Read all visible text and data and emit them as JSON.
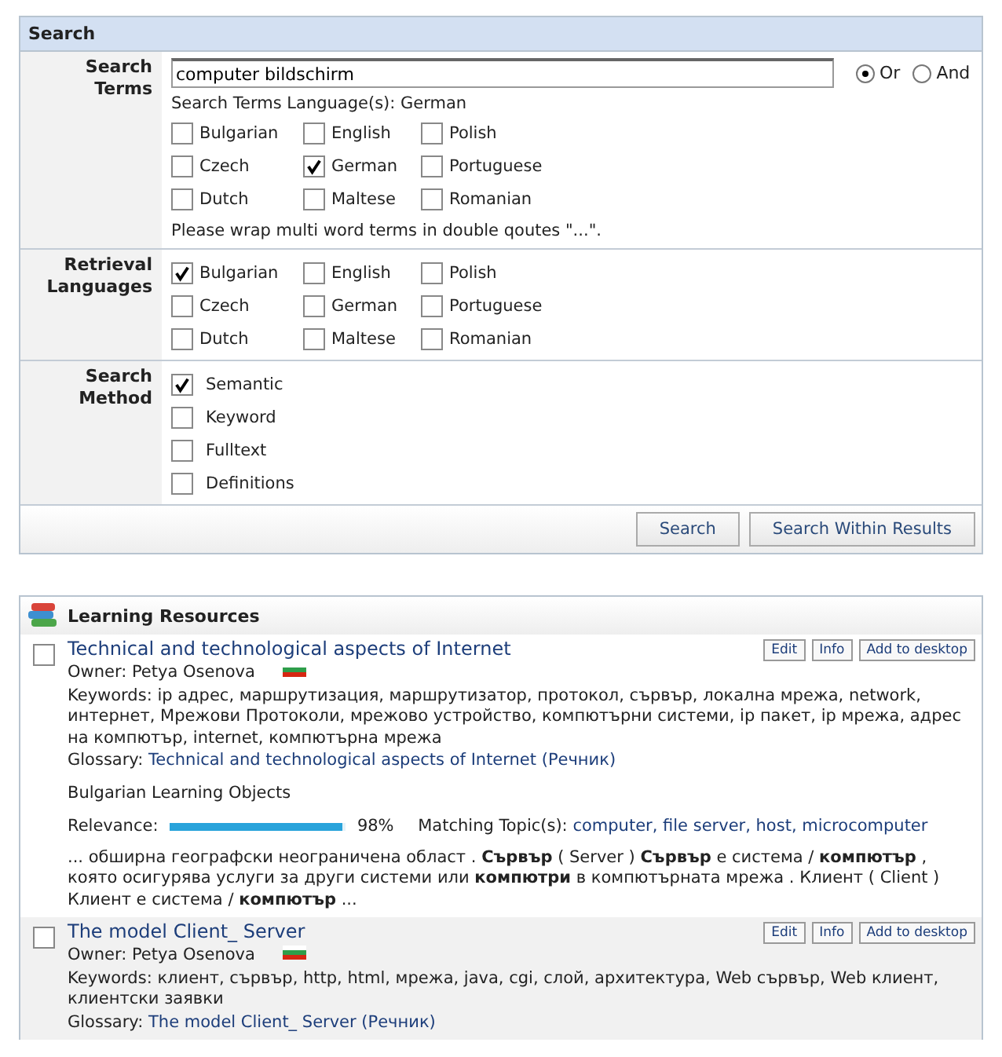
{
  "search": {
    "title": "Search",
    "terms": {
      "label": "Search Terms",
      "value": "computer bildschirm",
      "modes": [
        {
          "label": "Or",
          "selected": true
        },
        {
          "label": "And",
          "selected": false
        }
      ],
      "language_note": "Search Terms Language(s): German",
      "languages": [
        {
          "label": "Bulgarian",
          "checked": false
        },
        {
          "label": "English",
          "checked": false
        },
        {
          "label": "Polish",
          "checked": false
        },
        {
          "label": "Czech",
          "checked": false
        },
        {
          "label": "German",
          "checked": true
        },
        {
          "label": "Portuguese",
          "checked": false
        },
        {
          "label": "Dutch",
          "checked": false
        },
        {
          "label": "Maltese",
          "checked": false
        },
        {
          "label": "Romanian",
          "checked": false
        }
      ],
      "hint": "Please wrap multi word terms in double qoutes \"...\"."
    },
    "retrieval": {
      "label": "Retrieval Languages",
      "languages": [
        {
          "label": "Bulgarian",
          "checked": true
        },
        {
          "label": "English",
          "checked": false
        },
        {
          "label": "Polish",
          "checked": false
        },
        {
          "label": "Czech",
          "checked": false
        },
        {
          "label": "German",
          "checked": false
        },
        {
          "label": "Portuguese",
          "checked": false
        },
        {
          "label": "Dutch",
          "checked": false
        },
        {
          "label": "Maltese",
          "checked": false
        },
        {
          "label": "Romanian",
          "checked": false
        }
      ]
    },
    "method": {
      "label": "Search Method",
      "options": [
        {
          "label": "Semantic",
          "checked": true
        },
        {
          "label": "Keyword",
          "checked": false
        },
        {
          "label": "Fulltext",
          "checked": false
        },
        {
          "label": "Definitions",
          "checked": false
        }
      ]
    },
    "buttons": [
      "Search",
      "Search Within Results"
    ]
  },
  "resources": {
    "title": "Learning Resources",
    "items": [
      {
        "title": "Technical and technological aspects of Internet",
        "checked": false,
        "buttons": [
          "Edit",
          "Info",
          "Add to desktop"
        ],
        "owner": "Owner: Petya Osenova",
        "keywords": "Keywords: ip адрес, маршрутизация, маршрутизатор, протокол, сървър, локална мрежа, network, интернет, Мрежови Протоколи, мрежово устройство, компютърни системи, ip пакет, ip мрежа, адрес на компютър, internet, компютърна мрежа",
        "glossary_label": "Glossary:",
        "glossary_link": "Technical and technological aspects of Internet (Речник)",
        "group": "Bulgarian Learning Objects",
        "relevance_label": "Relevance:",
        "level": 0.98,
        "percent": "98%",
        "topics_label": "Matching Topic(s):",
        "topics": [
          "computer,",
          "file server,",
          "host,",
          "microcomputer"
        ],
        "snippet": "... обширна географски неограничена област . **Сървър** ( Server ) **Сървър** е система / **компютър** , която осигурява услуги за други системи или **компютри** в компютърната мрежа . Клиент ( Client ) Клиент е система / **компютър** ..."
      },
      {
        "title": "The model Client_ Server",
        "checked": false,
        "buttons": [
          "Edit",
          "Info",
          "Add to desktop"
        ],
        "owner": "Owner: Petya Osenova",
        "keywords": "Keywords: клиент, сървър, http, html, мрежа, java, cgi, слой, архитектура, Web сървър, Web клиент, клиентски заявки",
        "glossary_label": "Glossary:",
        "glossary_link": "The model Client_ Server (Речник)"
      }
    ]
  }
}
